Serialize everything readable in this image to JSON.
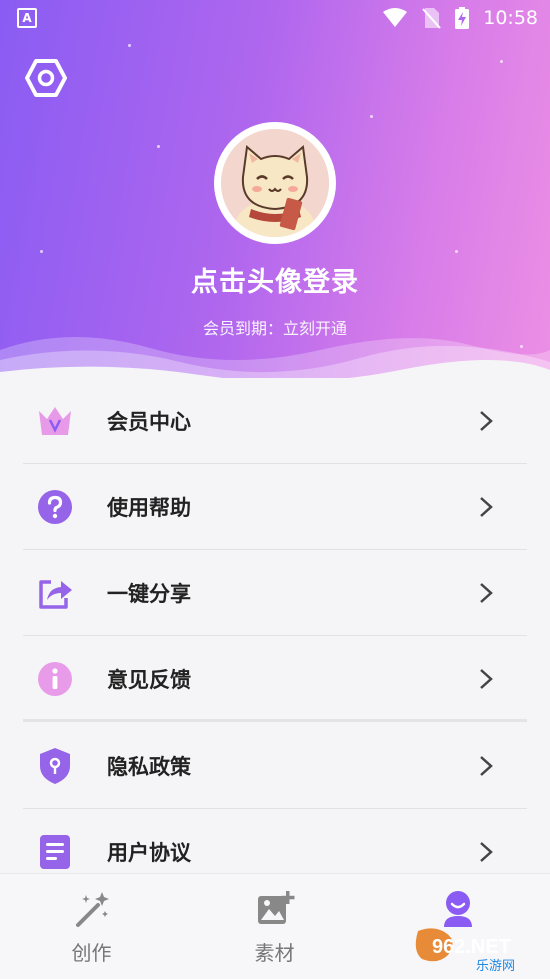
{
  "status_bar": {
    "left_icon": "A",
    "time": "10:58"
  },
  "header": {
    "settings_icon": "hexagon-settings-icon",
    "login_prompt": "点击头像登录",
    "member_status": "会员到期：立刻开通"
  },
  "menu": {
    "items": [
      {
        "label": "会员中心",
        "icon": "crown-icon"
      },
      {
        "label": "使用帮助",
        "icon": "help-icon"
      },
      {
        "label": "一键分享",
        "icon": "share-icon"
      },
      {
        "label": "意见反馈",
        "icon": "info-icon"
      },
      {
        "label": "隐私政策",
        "icon": "shield-icon"
      },
      {
        "label": "用户协议",
        "icon": "document-icon"
      }
    ]
  },
  "tabbar": {
    "tabs": [
      {
        "label": "创作",
        "icon": "magic-wand-icon"
      },
      {
        "label": "素材",
        "icon": "image-add-icon"
      },
      {
        "label": "",
        "icon": "user-icon"
      }
    ]
  },
  "watermark": {
    "logo": "962.NET",
    "subtitle": "乐游网"
  },
  "colors": {
    "accent": "#8a5cf3",
    "pink": "#e58ae6",
    "menu_icon": "#9564e8"
  }
}
